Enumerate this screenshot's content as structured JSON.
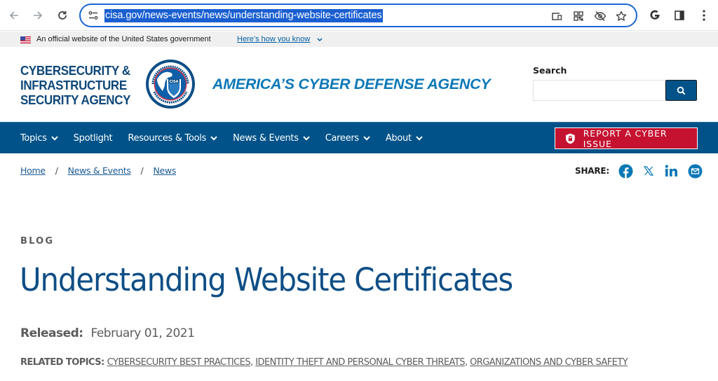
{
  "browser": {
    "url": "cisa.gov/news-events/news/understanding-website-certificates",
    "icons": [
      "back-icon",
      "forward-icon",
      "reload-icon",
      "site-settings-icon",
      "cast-icon",
      "qr-code-icon",
      "hide-eye-icon",
      "bookmark-star-icon",
      "google-icon",
      "side-panel-icon",
      "more-menu-icon"
    ]
  },
  "gov_banner": {
    "text": "An official website of the United States government",
    "link": "Here’s how you know"
  },
  "header": {
    "agency_line1": "CYBERSECURITY &",
    "agency_line2": "INFRASTRUCTURE",
    "agency_line3": "SECURITY AGENCY",
    "tagline": "AMERICA’S CYBER DEFENSE AGENCY",
    "search_label": "Search",
    "search_value": "",
    "search_placeholder": ""
  },
  "nav": {
    "items": [
      {
        "label": "Topics",
        "dropdown": true
      },
      {
        "label": "Spotlight",
        "dropdown": false
      },
      {
        "label": "Resources & Tools",
        "dropdown": true
      },
      {
        "label": "News & Events",
        "dropdown": true
      },
      {
        "label": "Careers",
        "dropdown": true
      },
      {
        "label": "About",
        "dropdown": true
      }
    ],
    "report_button": "REPORT A CYBER ISSUE"
  },
  "breadcrumb": {
    "items": [
      "Home",
      "News & Events",
      "News"
    ],
    "separator": "/"
  },
  "share": {
    "label": "SHARE:",
    "networks": [
      "facebook",
      "x",
      "linkedin",
      "email"
    ]
  },
  "article": {
    "eyebrow": "BLOG",
    "title": "Understanding Website Certificates",
    "released_label": "Released:",
    "released_date": "February 01, 2021",
    "related_label": "RELATED TOPICS:",
    "related_topics": [
      "CYBERSECURITY BEST PRACTICES",
      "IDENTITY THEFT AND PERSONAL CYBER THREATS",
      "ORGANIZATIONS AND CYBER SAFETY"
    ]
  },
  "colors": {
    "primary_blue": "#005288",
    "title_blue": "#0e4e85",
    "tagline_blue": "#0b78b6",
    "report_red": "#c41230",
    "url_highlight": "#1a5fd1"
  }
}
